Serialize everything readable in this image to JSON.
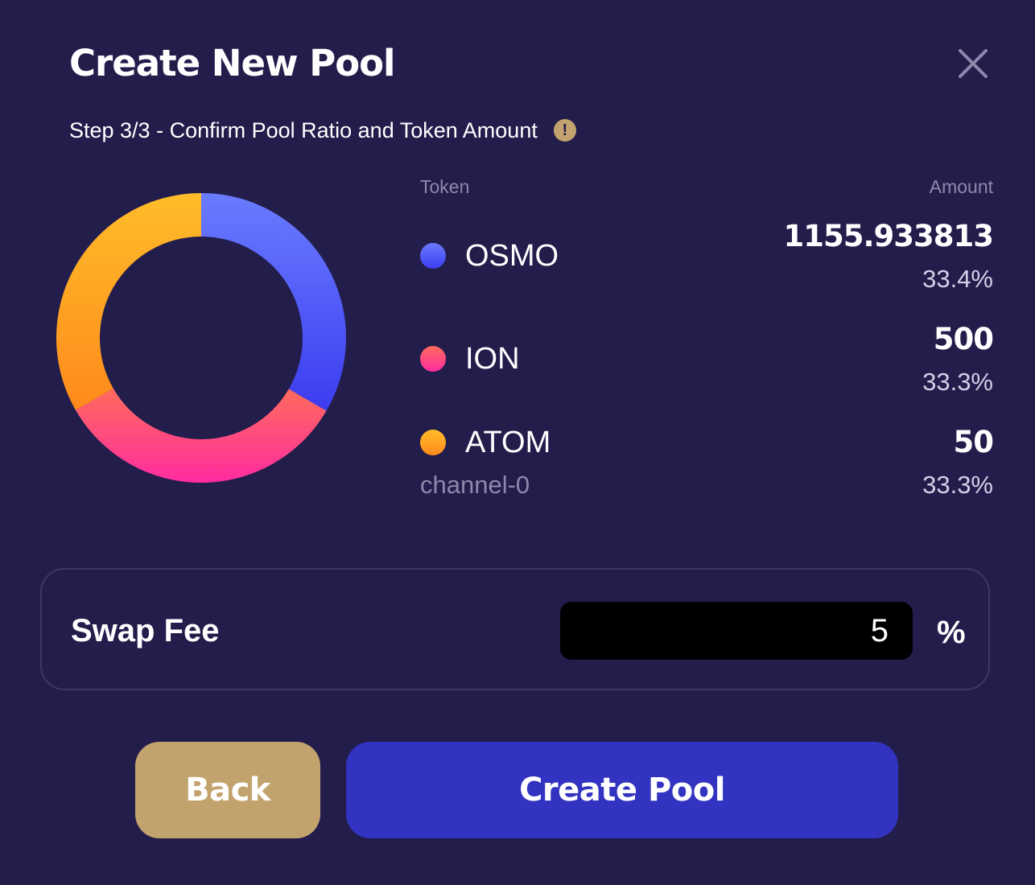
{
  "modal": {
    "title": "Create New Pool",
    "subtitle": "Step 3/3 - Confirm Pool Ratio and Token Amount",
    "info_icon": "!",
    "close_icon": "close-icon"
  },
  "table": {
    "token_header": "Token",
    "amount_header": "Amount"
  },
  "tokens": [
    {
      "name": "OSMO",
      "amount": "1155.933813",
      "percent": "33.4%",
      "ratio": 0.334,
      "color_top": "#6a7cff",
      "color_bottom": "#3c3cf0"
    },
    {
      "name": "ION",
      "amount": "500",
      "percent": "33.3%",
      "ratio": 0.333,
      "color_top": "#ff6b5c",
      "color_bottom": "#ff2ca0"
    },
    {
      "name": "ATOM",
      "channel": "channel-0",
      "amount": "50",
      "percent": "33.3%",
      "ratio": 0.333,
      "color_top": "#ffbc2a",
      "color_bottom": "#ff8a1c"
    }
  ],
  "swap_fee": {
    "label": "Swap Fee",
    "value": "5",
    "unit": "%"
  },
  "buttons": {
    "back": "Back",
    "create": "Create Pool"
  },
  "colors": {
    "background": "#231d4b",
    "back_button": "#c2a36e",
    "create_button": "#3333c2",
    "muted_text": "#8e88ad"
  }
}
